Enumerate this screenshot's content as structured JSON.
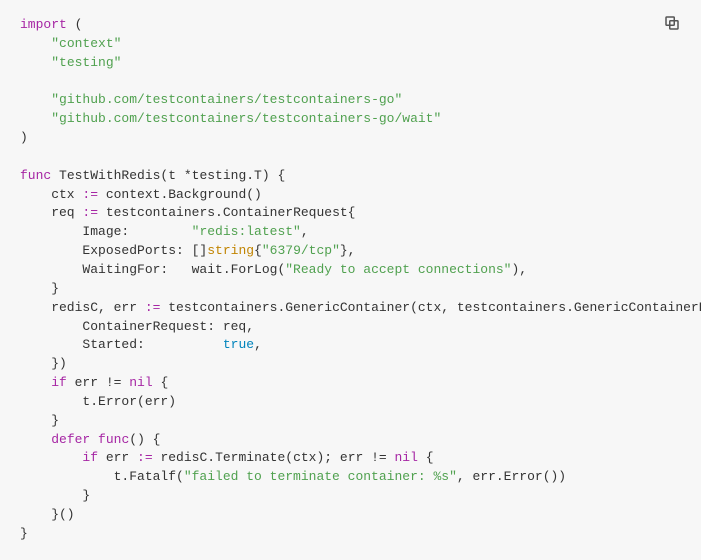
{
  "copy_button": {
    "label": "Copy"
  },
  "code": {
    "l1a": "import",
    "l1b": " (",
    "l2a": "    ",
    "l2b": "\"context\"",
    "l3a": "    ",
    "l3b": "\"testing\"",
    "l4": "",
    "l5a": "    ",
    "l5b": "\"github.com/testcontainers/testcontainers-go\"",
    "l6a": "    ",
    "l6b": "\"github.com/testcontainers/testcontainers-go/wait\"",
    "l7": ")",
    "l8": "",
    "l9a": "func",
    "l9b": " TestWithRedis(t *testing.T) {",
    "l10a": "    ctx ",
    "l10b": ":=",
    "l10c": " context.Background()",
    "l11a": "    req ",
    "l11b": ":=",
    "l11c": " testcontainers.ContainerRequest{",
    "l12a": "        Image:        ",
    "l12b": "\"redis:latest\"",
    "l12c": ",",
    "l13a": "        ExposedPorts: []",
    "l13b": "string",
    "l13c": "{",
    "l13d": "\"6379/tcp\"",
    "l13e": "},",
    "l14a": "        WaitingFor:   wait.ForLog(",
    "l14b": "\"Ready to accept connections\"",
    "l14c": "),",
    "l15": "    }",
    "l16a": "    redisC, err ",
    "l16b": ":=",
    "l16c": " testcontainers.GenericContainer(ctx, testcontainers.GenericContainerRequest{",
    "l17": "        ContainerRequest: req,",
    "l18a": "        Started:          ",
    "l18b": "true",
    "l18c": ",",
    "l19": "    })",
    "l20a": "    ",
    "l20b": "if",
    "l20c": " err != ",
    "l20d": "nil",
    "l20e": " {",
    "l21": "        t.Error(err)",
    "l22": "    }",
    "l23a": "    ",
    "l23b": "defer",
    "l23c": " ",
    "l23d": "func",
    "l23e": "() {",
    "l24a": "        ",
    "l24b": "if",
    "l24c": " err ",
    "l24d": ":=",
    "l24e": " redisC.Terminate(ctx); err != ",
    "l24f": "nil",
    "l24g": " {",
    "l25a": "            t.Fatalf(",
    "l25b": "\"failed to terminate container: %s\"",
    "l25c": ", err.Error())",
    "l26": "        }",
    "l27": "    }()",
    "l28": "}"
  }
}
